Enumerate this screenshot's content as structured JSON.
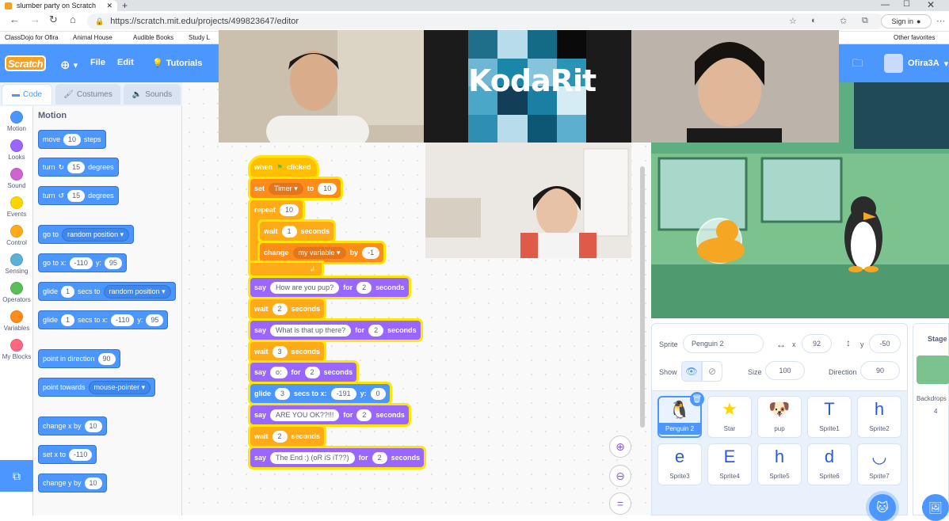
{
  "browser": {
    "tab_title": "slumber party on Scratch",
    "url": "https://scratch.mit.edu/projects/499823647/editor",
    "sign_in": "Sign in",
    "bookmarks": [
      "ClassDojo for Ofira",
      "Animal House",
      "Audible Books",
      "Study L",
      "Other favorites"
    ]
  },
  "menu": {
    "logo": "Scratch",
    "file": "File",
    "edit": "Edit",
    "tutorials": "Tutorials",
    "username": "Ofira3A"
  },
  "tabs": {
    "code": "Code",
    "costumes": "Costumes",
    "sounds": "Sounds"
  },
  "categories": [
    {
      "label": "Motion",
      "color": "#4c97ff"
    },
    {
      "label": "Looks",
      "color": "#9966ff"
    },
    {
      "label": "Sound",
      "color": "#cf63cf"
    },
    {
      "label": "Events",
      "color": "#ffd500"
    },
    {
      "label": "Control",
      "color": "#ffab19"
    },
    {
      "label": "Sensing",
      "color": "#5cb1d6"
    },
    {
      "label": "Operators",
      "color": "#59c059"
    },
    {
      "label": "Variables",
      "color": "#ff8c1a"
    },
    {
      "label": "My Blocks",
      "color": "#ff6680"
    }
  ],
  "palette": {
    "title": "Motion",
    "move": {
      "a": "move",
      "v": "10",
      "b": "steps"
    },
    "turn_r": {
      "a": "turn",
      "v": "15",
      "b": "degrees"
    },
    "turn_l": {
      "a": "turn",
      "v": "15",
      "b": "degrees"
    },
    "goto": {
      "a": "go to",
      "d": "random position"
    },
    "gotoxy": {
      "a": "go to x:",
      "x": "-110",
      "b": "y:",
      "y": "95"
    },
    "glide1": {
      "a": "glide",
      "v": "1",
      "b": "secs to",
      "d": "random position"
    },
    "glide2": {
      "a": "glide",
      "v": "1",
      "b": "secs to x:",
      "x": "-110",
      "c": "y:",
      "y": "95"
    },
    "point_dir": {
      "a": "point in direction",
      "v": "90"
    },
    "point_towards": {
      "a": "point towards",
      "d": "mouse-pointer"
    },
    "change_x": {
      "a": "change x by",
      "v": "10"
    },
    "set_x": {
      "a": "set x to",
      "v": "-110"
    },
    "change_y": {
      "a": "change y by",
      "v": "10"
    }
  },
  "script": {
    "when_flag": {
      "a": "when",
      "b": "clicked"
    },
    "set_timer": {
      "a": "set",
      "d": "Timer",
      "b": "to",
      "v": "10"
    },
    "repeat": {
      "a": "repeat",
      "v": "10"
    },
    "wait1": {
      "a": "wait",
      "v": "1",
      "b": "seconds"
    },
    "change_var": {
      "a": "change",
      "d": "my variable",
      "b": "by",
      "v": "-1"
    },
    "say1": {
      "a": "say",
      "t": "How are you pup?",
      "b": "for",
      "v": "2",
      "c": "seconds"
    },
    "wait2": {
      "a": "wait",
      "v": "2",
      "b": "seconds"
    },
    "say2": {
      "a": "say",
      "t": "What is that up there?",
      "b": "for",
      "v": "2",
      "c": "seconds"
    },
    "wait3": {
      "a": "wait",
      "v": "3",
      "b": "seconds"
    },
    "say3": {
      "a": "say",
      "t": "o:",
      "b": "for",
      "v": "2",
      "c": "seconds"
    },
    "glide": {
      "a": "glide",
      "v": "3",
      "b": "secs to x:",
      "x": "-191",
      "c": "y:",
      "y": "0"
    },
    "say4": {
      "a": "say",
      "t": "ARE YOU OK??!!!",
      "b": "for",
      "v": "2",
      "c": "seconds"
    },
    "wait4": {
      "a": "wait",
      "v": "2",
      "b": "seconds"
    },
    "say5": {
      "a": "say",
      "t": "The End :) (oR iS iT??)",
      "b": "for",
      "v": "2",
      "c": "seconds"
    }
  },
  "video": {
    "logo_text": "KodaRit"
  },
  "sprite_info": {
    "sprite_label": "Sprite",
    "sprite_name": "Penguin 2",
    "x_label": "x",
    "x": "92",
    "y_label": "y",
    "y": "-50",
    "show_label": "Show",
    "size_label": "Size",
    "size": "100",
    "direction_label": "Direction",
    "direction": "90"
  },
  "sprites": [
    "Penguin 2",
    "Star",
    "pup",
    "Sprite1",
    "Sprite2",
    "Sprite3",
    "Sprite4",
    "Sprite5",
    "Sprite6",
    "Sprite7"
  ],
  "sprite_glyphs": [
    "🐧",
    "★",
    "🐶",
    "T",
    "h",
    "e",
    "E",
    "h",
    "d",
    "◡"
  ],
  "stage_pane": {
    "title": "Stage",
    "backdrops_label": "Backdrops",
    "backdrops_count": "4"
  }
}
